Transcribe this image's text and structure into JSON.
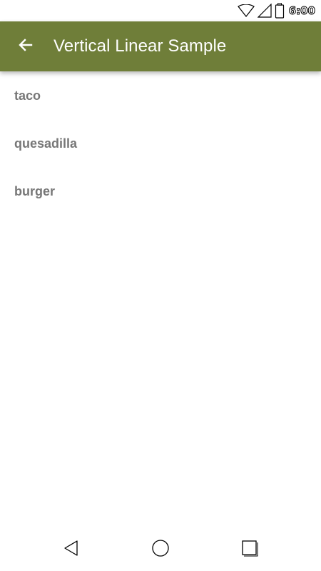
{
  "status_bar": {
    "time": "6:00",
    "icons": [
      "wifi-icon",
      "cell-signal-icon",
      "battery-icon"
    ]
  },
  "app_bar": {
    "title": "Vertical Linear Sample",
    "back_icon": "arrow-back-icon",
    "background_color": "#6f7e39"
  },
  "list": {
    "items": [
      {
        "label": "taco"
      },
      {
        "label": "quesadilla"
      },
      {
        "label": "burger"
      }
    ]
  },
  "nav_bar": {
    "buttons": [
      "nav-back-icon",
      "nav-home-icon",
      "nav-recents-icon"
    ]
  }
}
